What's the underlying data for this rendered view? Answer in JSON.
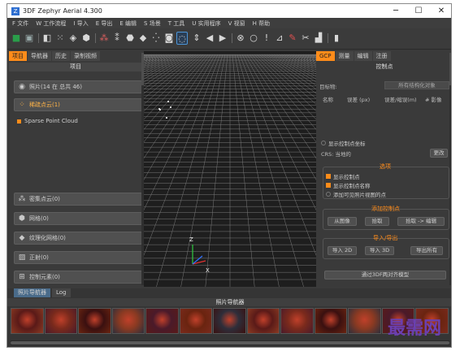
{
  "window": {
    "title": "3DF Zephyr Aerial 4.300",
    "app_icon": "Z",
    "controls": {
      "minimize": "─",
      "maximize": "☐",
      "close": "✕"
    }
  },
  "menu": [
    "F 文件",
    "W 工作流程",
    "I 导入",
    "E 导出",
    "E 编辑",
    "S 场景",
    "T 工具",
    "U 实用程序",
    "V 视窗",
    "H 帮助"
  ],
  "left_panel": {
    "tabs": [
      "项目",
      "导航器",
      "历史",
      "录制视频"
    ],
    "active_tab": 0,
    "header": "项目",
    "photos_label": "照片(14 在 总共 46)",
    "sparse_label": "稀疏点云(1)",
    "sparse_item": "Sparse Point Cloud",
    "dense_label": "密集点云(0)",
    "mesh_label": "网格(0)",
    "textured_label": "纹理化网格(0)",
    "ortho_label": "正射(0)",
    "control_label": "控制元素(0)"
  },
  "right_panel": {
    "tabs": [
      "GCP",
      "测量",
      "编辑",
      "注册"
    ],
    "active_tab": 0,
    "header": "控制点",
    "target_label": "目标物:",
    "target_value": "所有结构化对象",
    "col_name": "名称",
    "col_error": "误差 (px)",
    "col_reproj": "误差/缩误(m)",
    "col_images": "# 影像",
    "show_gcp_coords": "显示控制点坐标",
    "crs_label": "CRS: 当地的",
    "crs_change": "更改",
    "options_title": "选项",
    "opt_show_points": "显示控制点",
    "opt_show_names": "显示控制点名称",
    "opt_add_visible": "添加可见照片视图的点",
    "add_title": "添加控制点",
    "btn_from_image": "从图像",
    "btn_pick": "拾取",
    "btn_pick_edit": "拾取 -> 编辑",
    "io_title": "导入/导出",
    "btn_import_2d": "导入 2D",
    "btn_import_3d": "导入 3D",
    "btn_export_all": "导出所有",
    "btn_align": "通过3DF两对齐模型"
  },
  "viewport": {
    "axis_z": "Z",
    "axis_x": "X"
  },
  "bottom_panel": {
    "tabs": [
      "照片导航器",
      "Log"
    ],
    "active_tab": 0,
    "header": "照片导航器",
    "thumbnail_count": 13
  },
  "watermark": "最需网",
  "colors": {
    "accent": "#ff8c1a",
    "background": "#3a3a3a",
    "viewport": "#1e1e1e",
    "watermark": "#6b3fb0"
  }
}
